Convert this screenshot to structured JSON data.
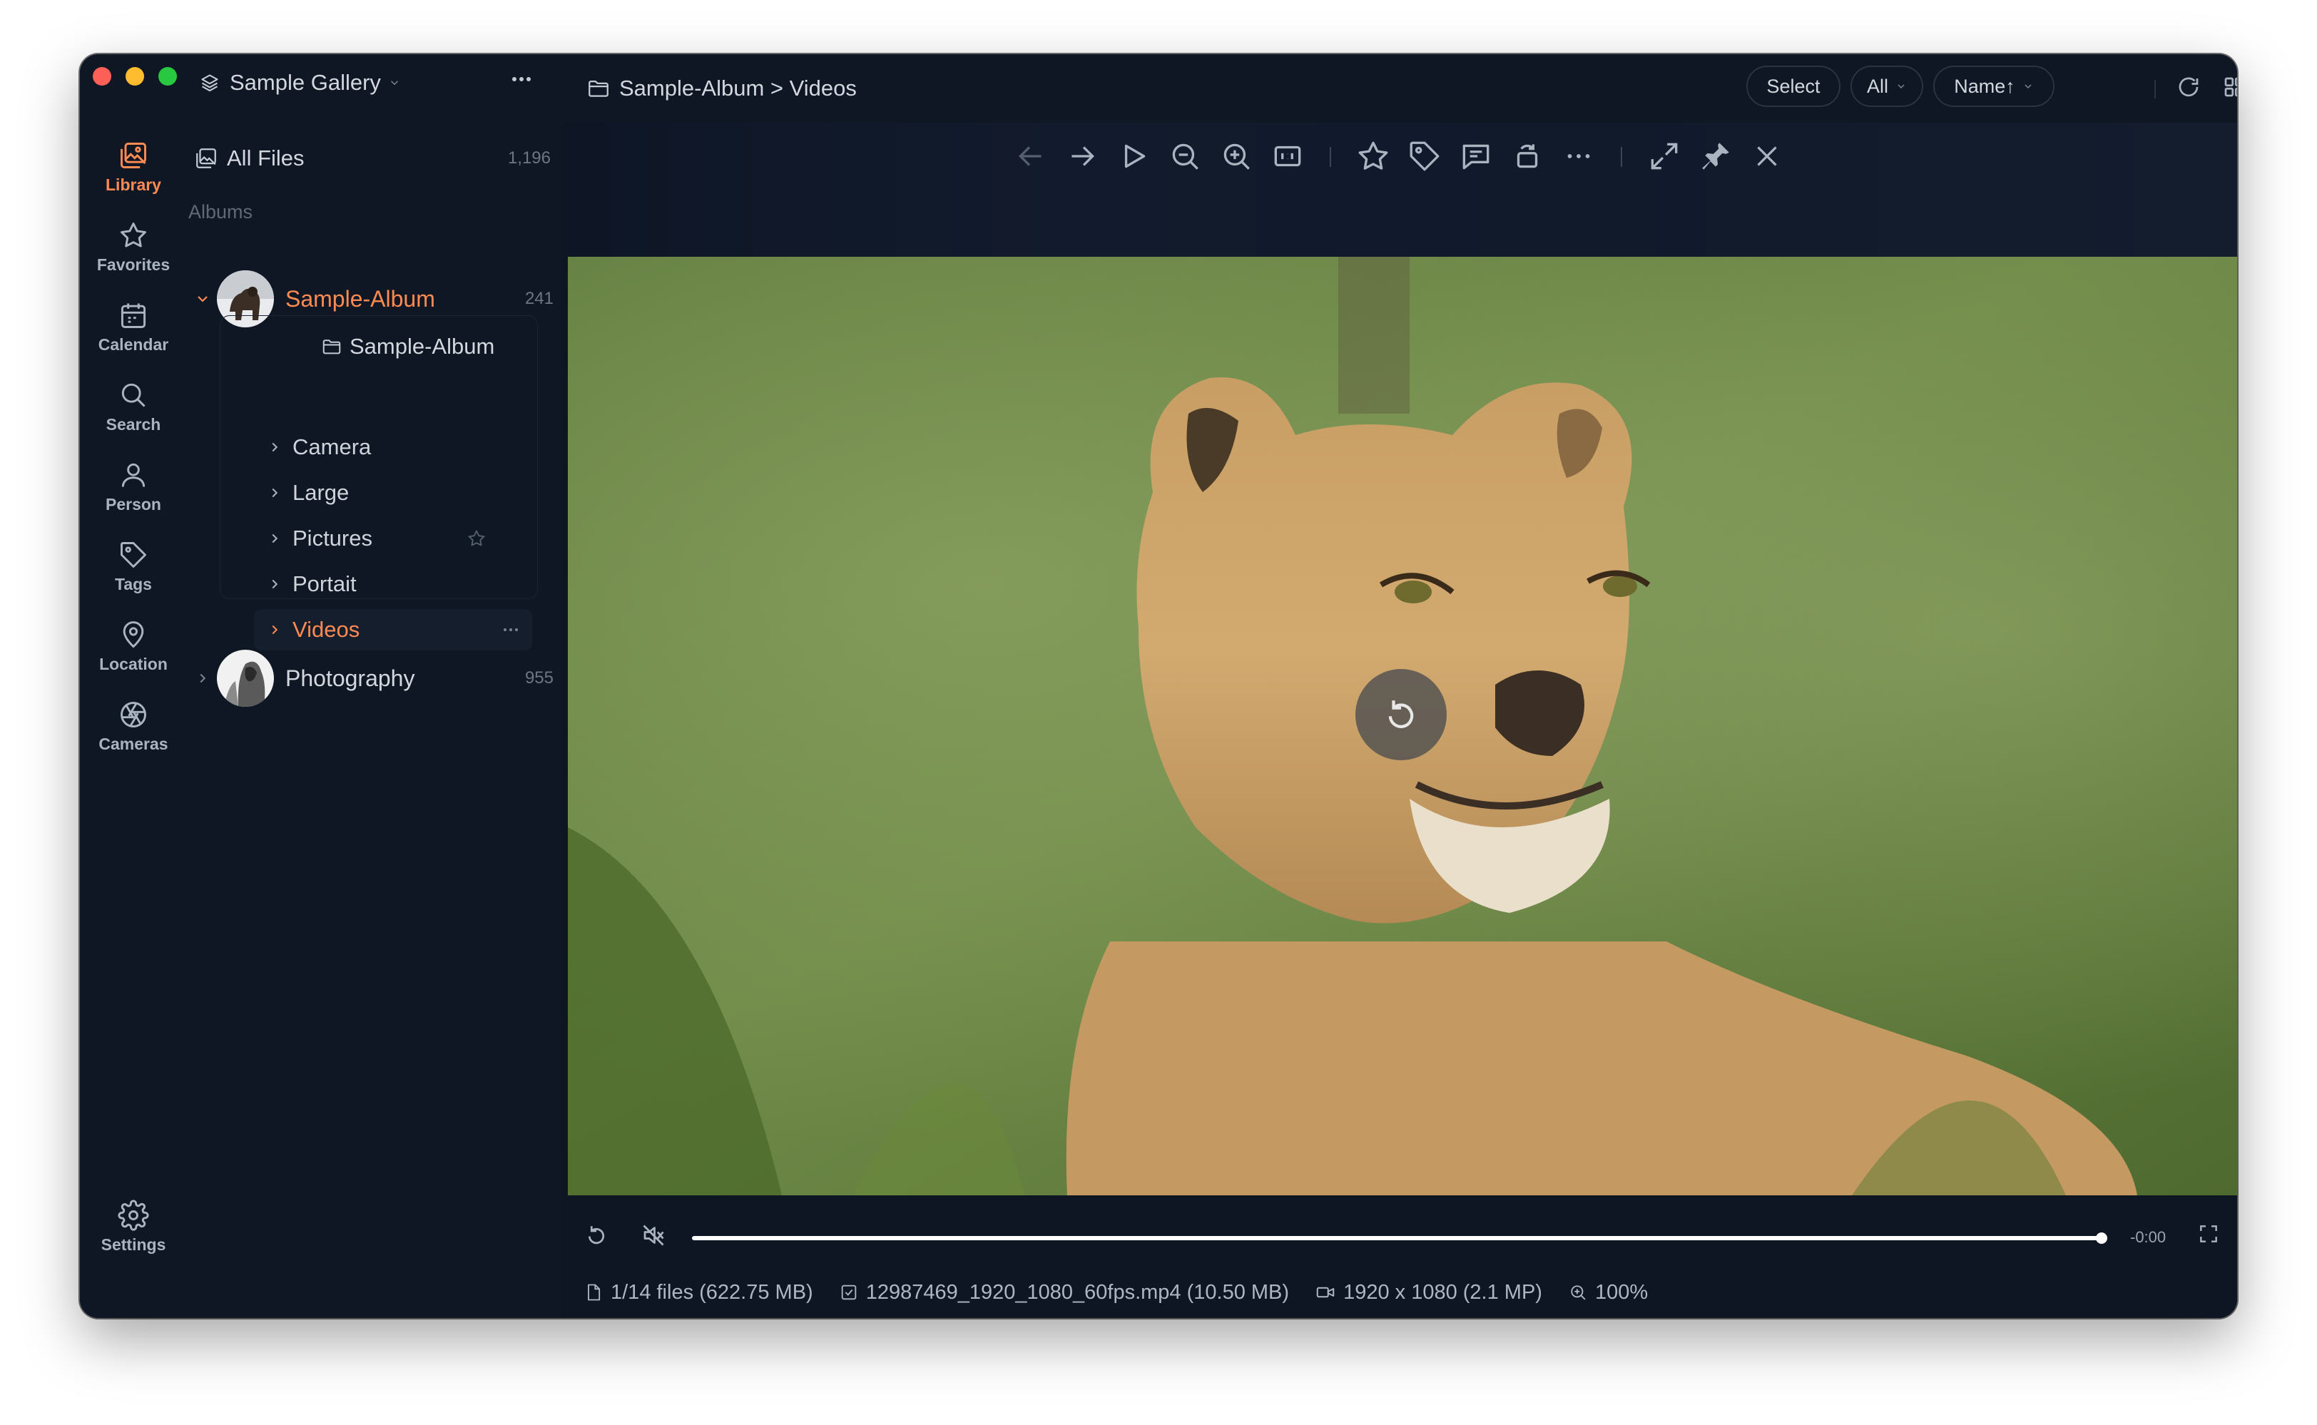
{
  "window": {
    "gallery_title": "Sample Gallery"
  },
  "rail": {
    "items": [
      {
        "label": "Library",
        "icon": "library-icon",
        "active": true
      },
      {
        "label": "Favorites",
        "icon": "star-icon"
      },
      {
        "label": "Calendar",
        "icon": "calendar-icon"
      },
      {
        "label": "Search",
        "icon": "search-icon"
      },
      {
        "label": "Person",
        "icon": "person-icon"
      },
      {
        "label": "Tags",
        "icon": "tag-icon"
      },
      {
        "label": "Location",
        "icon": "location-pin-icon"
      },
      {
        "label": "Cameras",
        "icon": "aperture-icon"
      }
    ],
    "settings_label": "Settings"
  },
  "library": {
    "all_files_label": "All Files",
    "all_files_count": "1,196",
    "albums_label": "Albums",
    "albums": [
      {
        "name": "Sample-Album",
        "count": "241",
        "expanded": true
      },
      {
        "name": "Photography",
        "count": "955",
        "expanded": false
      }
    ],
    "tree_root": "Sample-Album",
    "folders": [
      "Camera",
      "Large",
      "Pictures",
      "Portait",
      "Videos"
    ],
    "active_folder": "Videos"
  },
  "topbar": {
    "breadcrumb": "Sample-Album > Videos",
    "select_label": "Select",
    "filter_label": "All",
    "sort_label": "Name↑"
  },
  "viewer": {
    "time_remaining": "-0:00",
    "status": {
      "files": "1/14 files (622.75 MB)",
      "filename": "12987469_1920_1080_60fps.mp4 (10.50 MB)",
      "dimensions": "1920 x 1080 (2.1 MP)",
      "zoom": "100%"
    },
    "playback_progress": 1.0
  },
  "colors": {
    "accent": "#ff8a52",
    "background": "#0e1624",
    "sidebar": "#0f1724"
  }
}
